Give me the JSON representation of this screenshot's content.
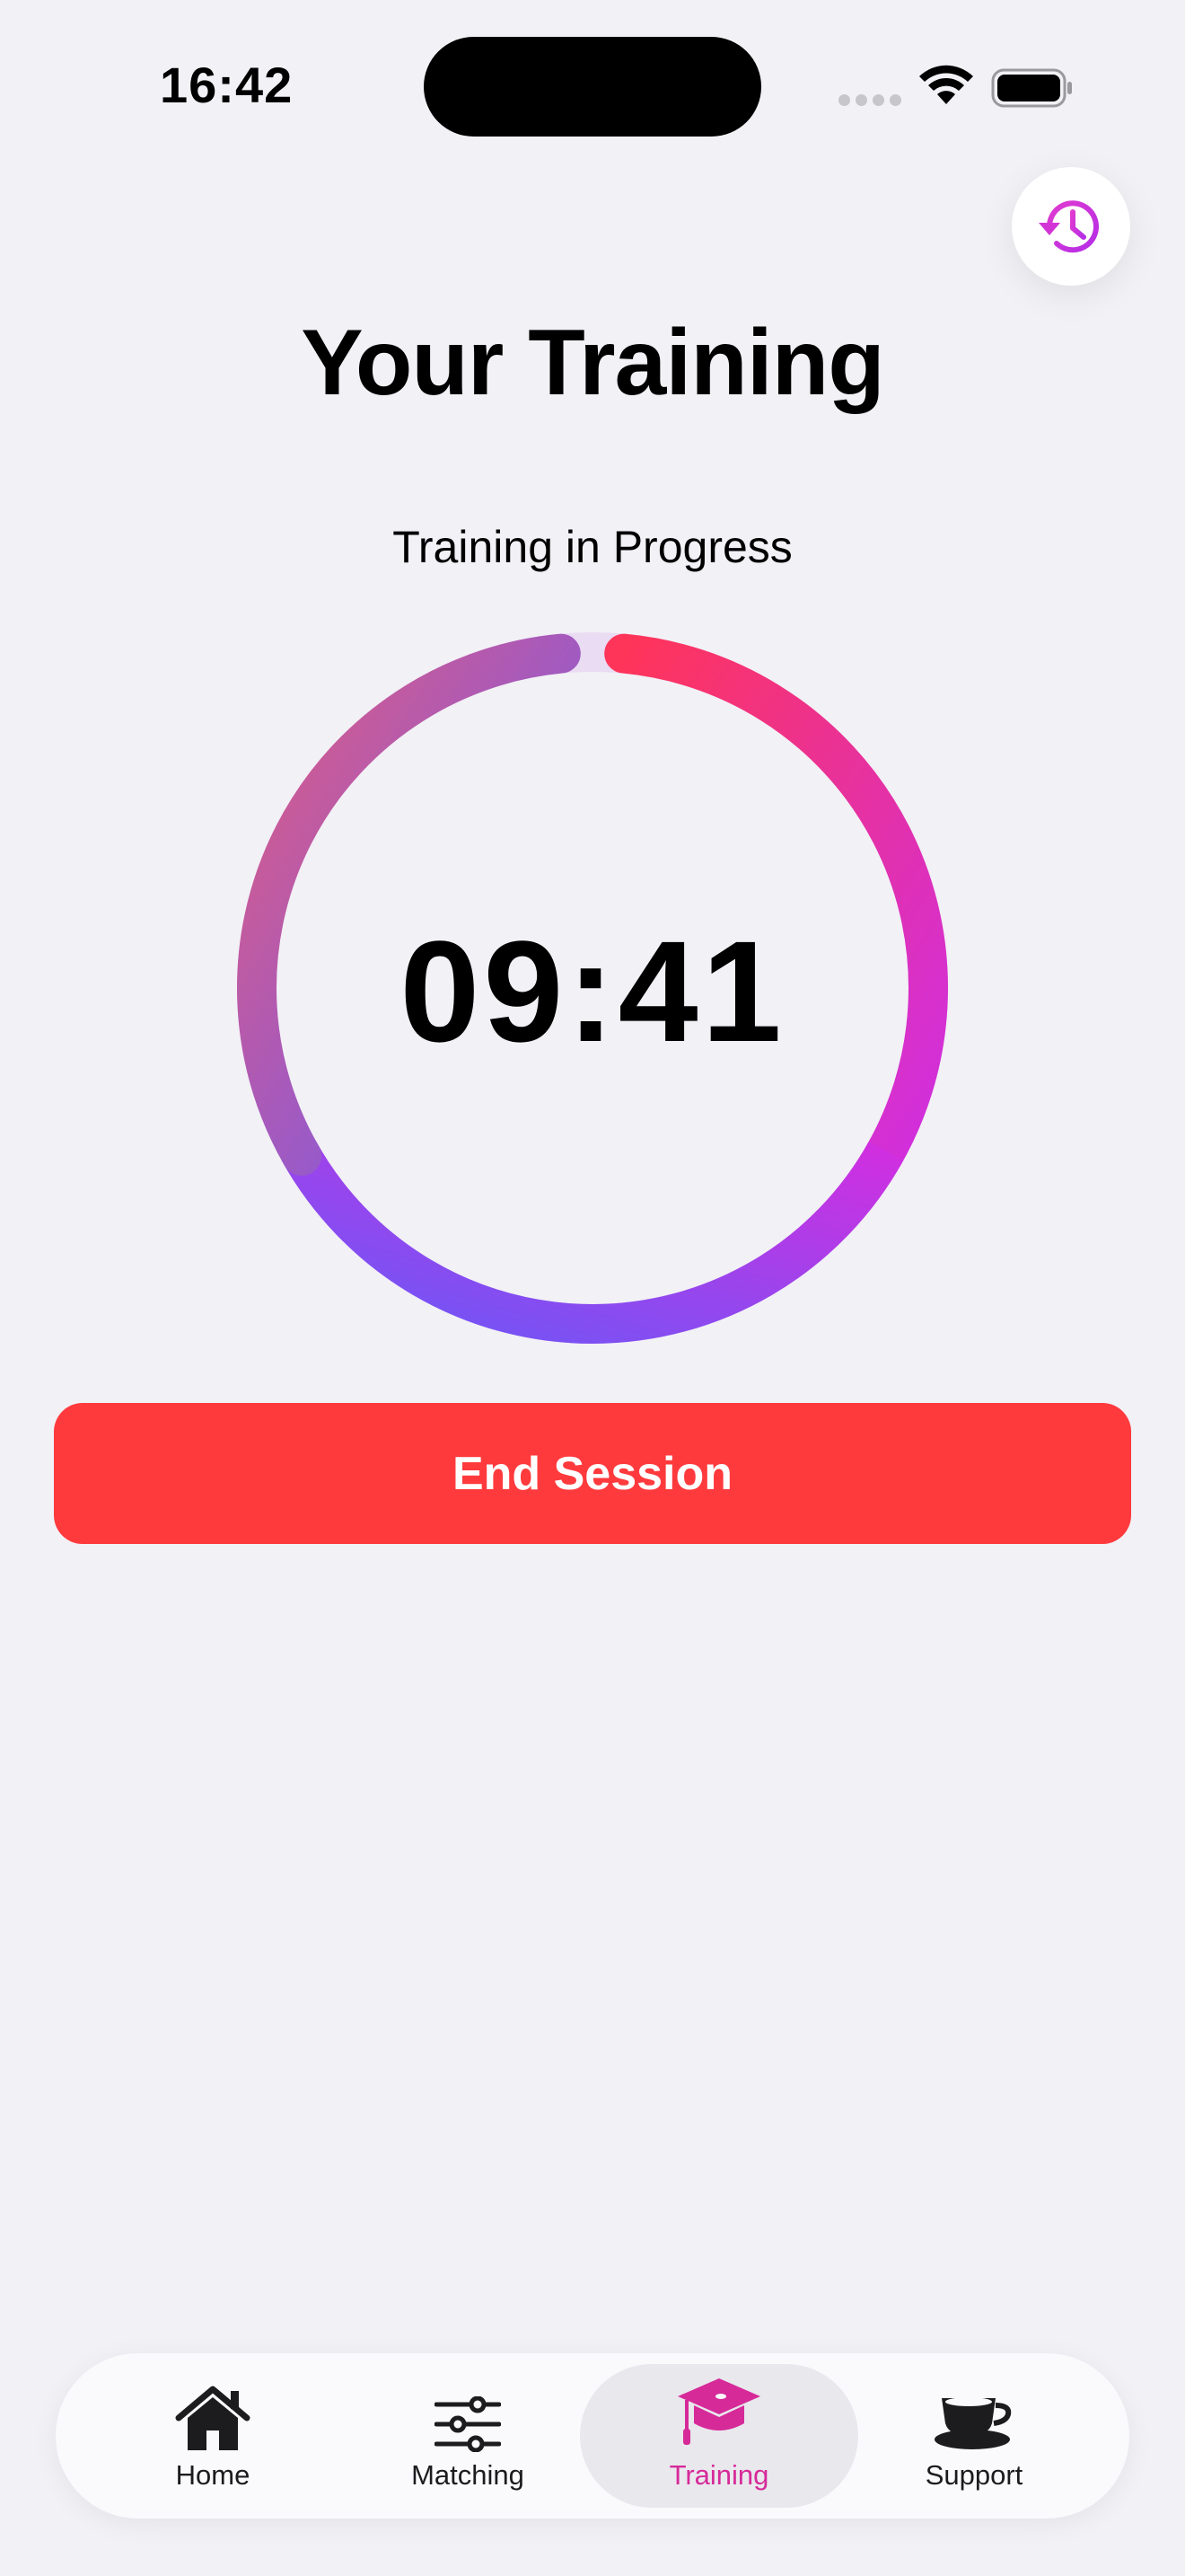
{
  "status_bar": {
    "time": "16:42"
  },
  "header": {
    "title": "Your Training",
    "history_icon": "history-clock-icon"
  },
  "session": {
    "status": "Training in Progress",
    "timer": "09:41",
    "progress_fraction": 0.97,
    "gradient_colors": [
      "#ff3459",
      "#d02fe0",
      "#6a58f7",
      "#df5c83"
    ]
  },
  "actions": {
    "end_label": "End Session",
    "end_color": "#ff3a3d"
  },
  "tabbar": {
    "active_color": "#d62a99",
    "tabs": [
      {
        "label": "Home",
        "icon": "house-icon"
      },
      {
        "label": "Matching",
        "icon": "sliders-icon"
      },
      {
        "label": "Training",
        "icon": "graduation-cap-icon",
        "active": true
      },
      {
        "label": "Support",
        "icon": "coffee-cup-icon"
      }
    ]
  }
}
